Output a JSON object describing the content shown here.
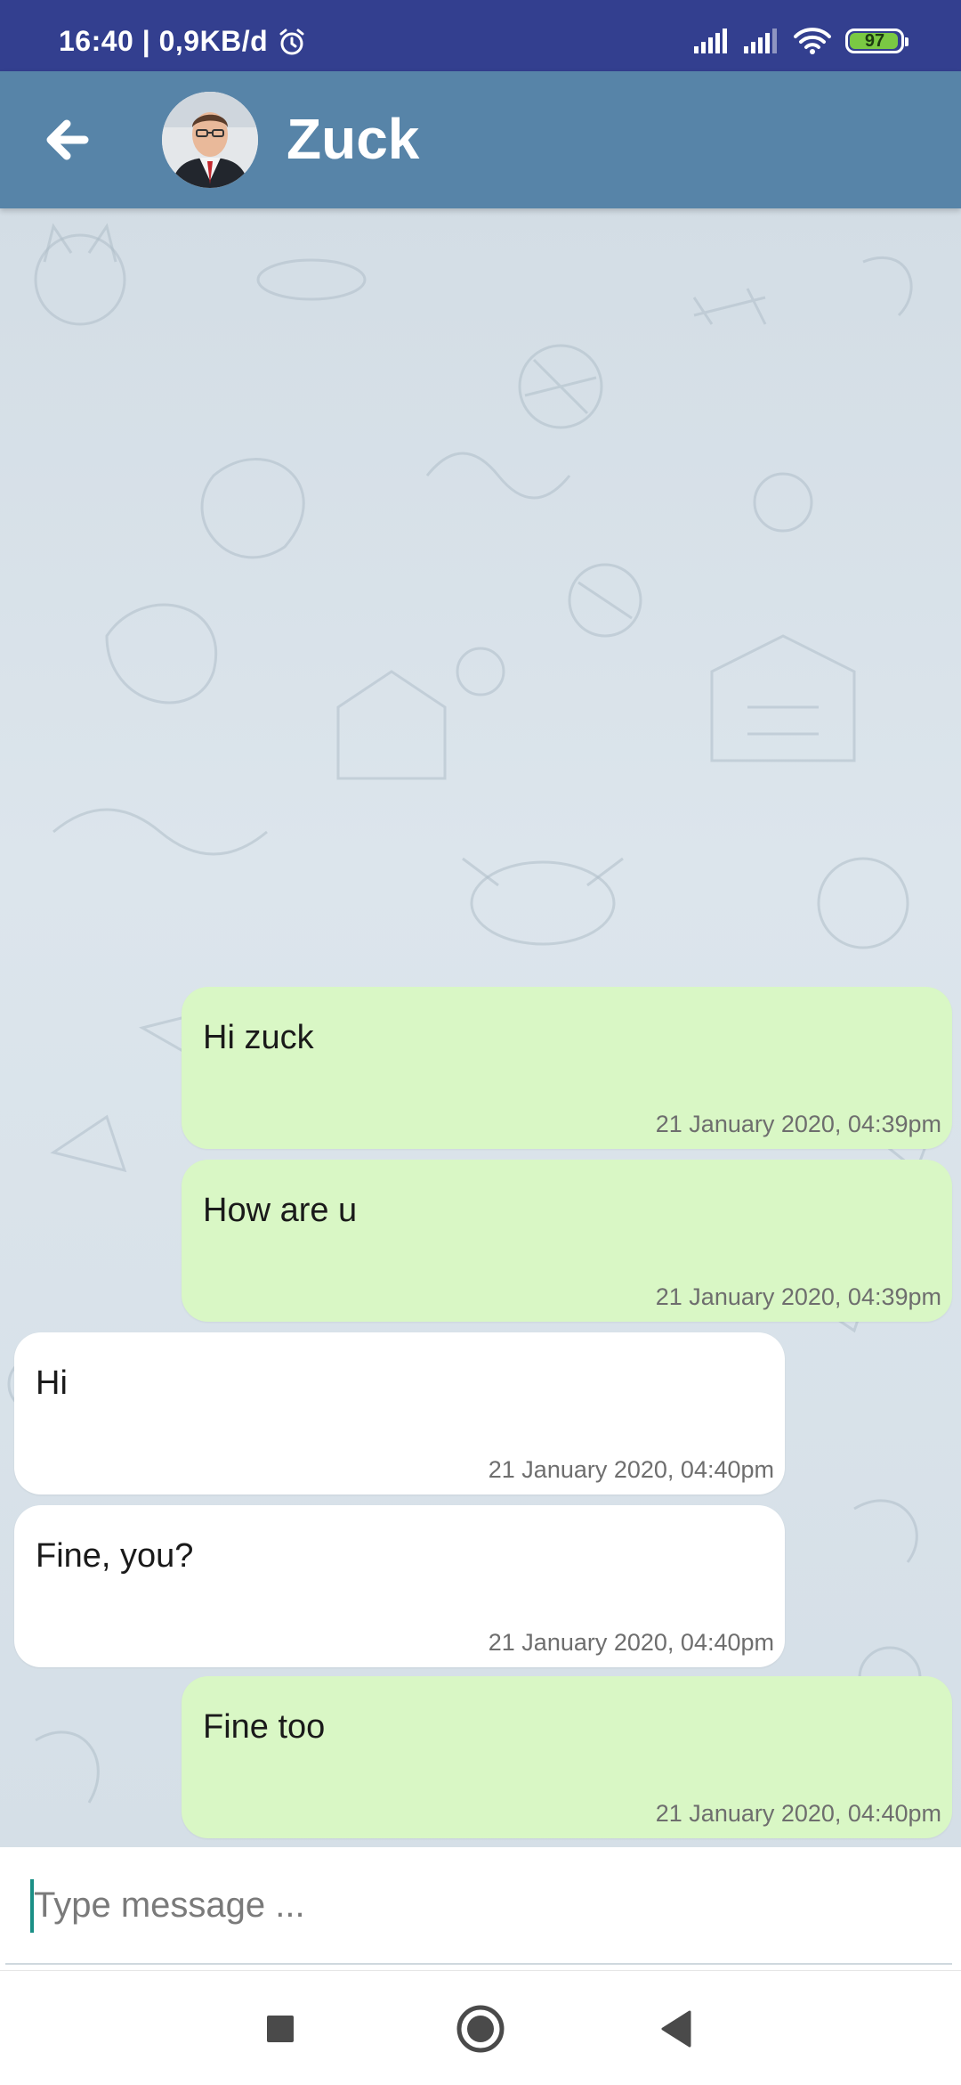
{
  "status_bar": {
    "time_and_speed": "16:40 | 0,9KB/d",
    "battery_level": "97",
    "battery_fraction": 0.97,
    "icons": [
      "alarm-icon",
      "signal-icon",
      "signal-icon",
      "wifi-icon",
      "battery-icon"
    ]
  },
  "header": {
    "contact_name": "Zuck",
    "back_icon": "arrow-left-icon",
    "avatar_icon": "avatar"
  },
  "messages": [
    {
      "direction": "outgoing",
      "text": "Hi zuck",
      "timestamp": "21 January 2020, 04:39pm"
    },
    {
      "direction": "outgoing",
      "text": "How are u",
      "timestamp": "21 January 2020, 04:39pm"
    },
    {
      "direction": "incoming",
      "text": "Hi",
      "timestamp": "21 January 2020, 04:40pm"
    },
    {
      "direction": "incoming",
      "text": "Fine, you?",
      "timestamp": "21 January 2020, 04:40pm"
    },
    {
      "direction": "outgoing",
      "text": "Fine too",
      "timestamp": "21 January 2020, 04:40pm"
    }
  ],
  "composer": {
    "placeholder": "Type message ...",
    "value": ""
  },
  "nav_bar": {
    "icons": [
      "recents-square-icon",
      "home-circle-icon",
      "back-triangle-icon"
    ]
  },
  "colors": {
    "status_bar": "#333f8f",
    "app_bar": "#5784a8",
    "outgoing_bubble": "#d9f7c5",
    "incoming_bubble": "#ffffff",
    "battery_fill": "#7ac943",
    "cursor": "#1a8f86"
  }
}
